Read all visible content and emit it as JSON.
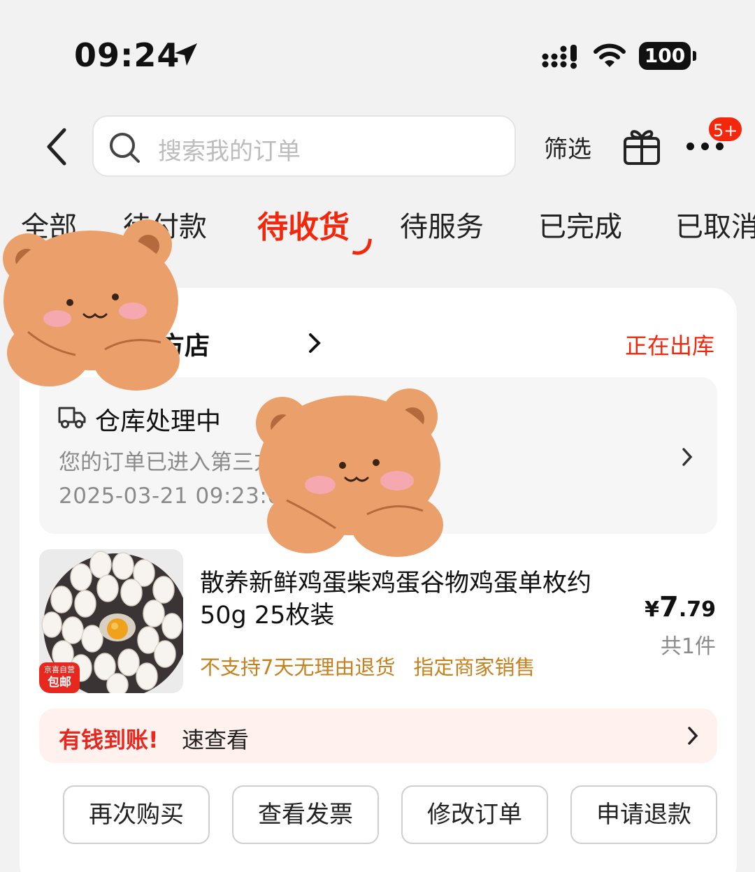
{
  "status_bar": {
    "time": "09:24",
    "battery": "100"
  },
  "header": {
    "search_placeholder": "搜索我的订单",
    "filter_label": "筛选",
    "more_badge": "5+"
  },
  "tabs": [
    {
      "label": "全部"
    },
    {
      "label": "待付款"
    },
    {
      "label": "待收货",
      "active": true
    },
    {
      "label": "待服务"
    },
    {
      "label": "已完成"
    },
    {
      "label": "已取消"
    }
  ],
  "order": {
    "store_name": "自营官方店",
    "status": "正在出库",
    "logistics": {
      "title": "仓库处理中",
      "description": "您的订单已进入第三方仓库准备出库",
      "time": "2025-03-21 09:23:05"
    },
    "product": {
      "badge_top": "京喜自营",
      "badge_main": "包邮",
      "title": "散养新鲜鸡蛋柴鸡蛋谷物鸡蛋单枚约50g 25枚装",
      "tags": [
        "不支持7天无理由退货",
        "指定商家销售"
      ],
      "price_symbol": "¥",
      "price_int": "7",
      "price_dec": ".79",
      "quantity": "共1件"
    },
    "promo": {
      "highlight": "有钱到账!",
      "text": "速查看"
    },
    "actions": {
      "rebuy": "再次购买",
      "invoice": "查看发票",
      "modify": "修改订单",
      "refund": "申请退款"
    }
  },
  "colors": {
    "accent": "#f2270c",
    "tag": "#c7801e",
    "sticker": "#eba06c"
  }
}
